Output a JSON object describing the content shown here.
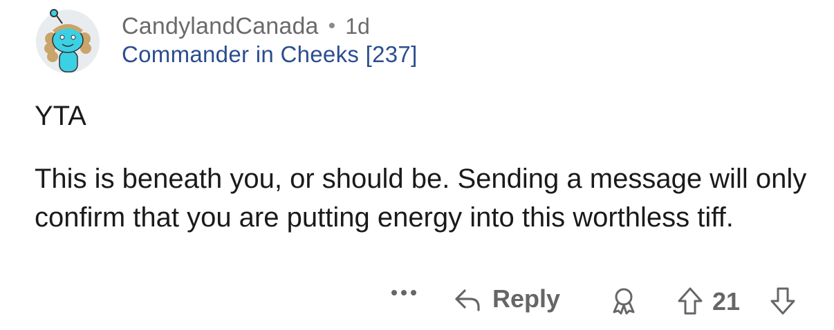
{
  "comment": {
    "username": "CandylandCanada",
    "separator": "•",
    "age": "1d",
    "flair": "Commander in Cheeks [237]",
    "paragraphs": [
      "YTA",
      "This is beneath you, or should be. Sending a message will only confirm that you are putting energy into this worthless tiff."
    ]
  },
  "actions": {
    "reply_label": "Reply",
    "score": "21",
    "icons": [
      "more-options-icon",
      "reply-arrow-icon",
      "award-icon",
      "upvote-icon",
      "downvote-icon"
    ]
  },
  "colors": {
    "username": "#6a6a6a",
    "flair": "#2b4d8f",
    "body": "#1a1a1a",
    "action": "#666666",
    "avatar_bg": "#e9ecef",
    "avatar_body": "#3cd0e4"
  }
}
